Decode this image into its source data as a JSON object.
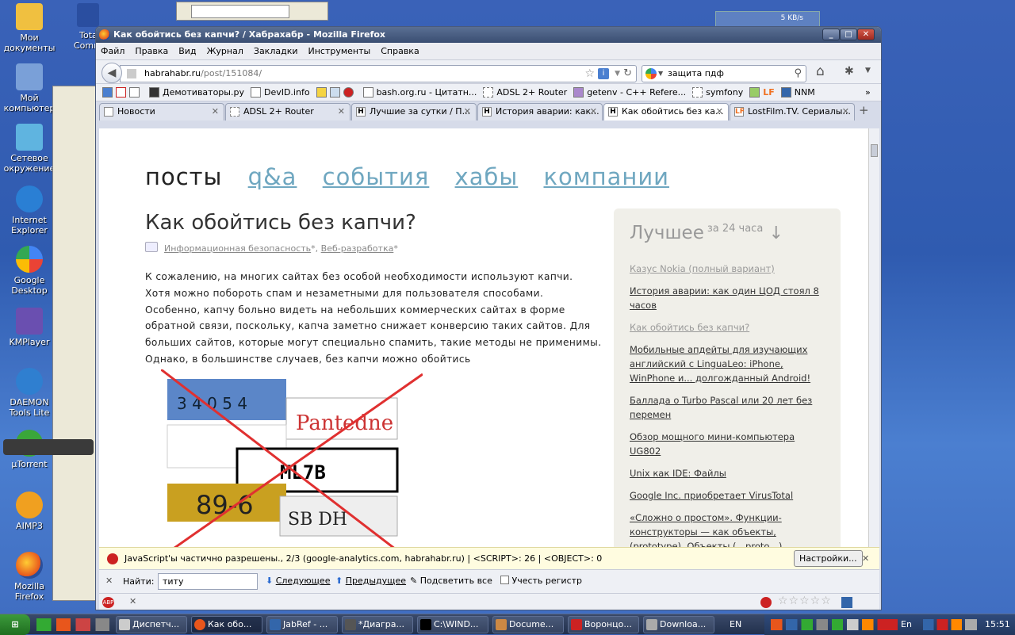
{
  "desktop": {
    "icons": [
      {
        "label": "Мои документы"
      },
      {
        "label": "Мой компьютер"
      },
      {
        "label": "Сетевое окружение"
      },
      {
        "label": "Internet Explorer"
      },
      {
        "label": "Google Desktop"
      },
      {
        "label": "KMPlayer"
      },
      {
        "label": "DAEMON Tools Lite"
      },
      {
        "label": "µTorrent"
      },
      {
        "label": "AIMP3"
      },
      {
        "label": "Mozilla Firefox"
      }
    ],
    "bg_window_label": "Total Comma",
    "netmeter": "5 KB/s"
  },
  "window": {
    "title": "Как обойтись без капчи? / Хабрахабр - Mozilla Firefox",
    "minimize": "_",
    "maximize": "□",
    "close": "✕"
  },
  "menu": [
    "Файл",
    "Правка",
    "Вид",
    "Журнал",
    "Закладки",
    "Инструменты",
    "Справка"
  ],
  "navbar": {
    "url_host": "habrahabr.ru",
    "url_path": "/post/151084/",
    "search_value": "защита пдф"
  },
  "bookmarks": [
    "Демотиваторы.ру",
    "DevID.info",
    "bash.org.ru - Цитатн...",
    "ADSL 2+ Router",
    "getenv - C++ Refere...",
    "symfony",
    "LF",
    "NNM"
  ],
  "tabs": [
    {
      "label": "Новости"
    },
    {
      "label": "ADSL 2+ Router"
    },
    {
      "label": "Лучшие за сутки / П..."
    },
    {
      "label": "История аварии: как..."
    },
    {
      "label": "Как обойтись без ка..."
    },
    {
      "label": "LostFilm.TV. Сериалы..."
    }
  ],
  "page": {
    "nav": {
      "current": "посты",
      "links": [
        "q&a",
        "события",
        "хабы",
        "компании"
      ]
    },
    "title": "Как обойтись без капчи?",
    "tags": [
      "Информационная безопасность",
      "Веб-разработка"
    ],
    "tag_mark": "*",
    "tag_sep": ", ",
    "body_lines": [
      "К сожалению, на многих сайтах без особой необходимости используют капчи.",
      "Хотя можно побороть спам и незаметными для пользователя способами.",
      "Особенно, капчу больно видеть на небольших коммерческих сайтах в форме",
      "обратной связи, поскольку, капча заметно снижает конверсию таких сайтов. Для",
      "больших сайтов, которые могут специально спамить, такие методы не применимы.",
      "Однако, в большинстве случаев, без капчи можно обойтись"
    ],
    "captcha_texts": [
      "3 4 0 5 4",
      "Pantedne",
      "ML7B",
      "89-6",
      "SB DH"
    ],
    "sidebar": {
      "heading": "Лучшее",
      "sub": "за 24 часа",
      "arrow": "↓",
      "items": [
        {
          "text": "Казус Nokia (полный вариант)",
          "visited": true
        },
        {
          "text": "История аварии: как один ЦОД стоял 8 часов",
          "visited": false
        },
        {
          "text": "Как обойтись без капчи?",
          "visited": true
        },
        {
          "text": "Мобильные апдейты для изучающих английский с LinguaLeo: iPhone, WinPhone и... долгожданный Android!",
          "visited": false
        },
        {
          "text": "Баллада о Turbo Pascal или 20 лет без перемен",
          "visited": false
        },
        {
          "text": "Обзор мощного мини-компьютера UG802",
          "visited": false
        },
        {
          "text": "Unix как IDE: Файлы",
          "visited": false
        },
        {
          "text": "Google Inc. приобретает VirusTotal",
          "visited": false
        },
        {
          "text": "«Сложно о простом». Функции-конструкторы — как объекты,(prototype). Объекты,(__proto__). constructor, ={}, как функция-конструктор new Object().",
          "visited": false
        }
      ]
    }
  },
  "jsbar": {
    "text": "JavaScript'ы частично разрешены., 2/3 (google-analytics.com, habrahabr.ru) | <SCRIPT>: 26 | <OBJECT>: 0",
    "settings": "Настройки..."
  },
  "findbar": {
    "label": "Найти:",
    "value": "титу",
    "next": "Следующее",
    "prev": "Предыдущее",
    "highlight": "Подсветить все",
    "matchcase": "Учесть регистр"
  },
  "taskbar": {
    "items": [
      "Диспетч...",
      "Как обо...",
      "JabRef - ...",
      "*Диагра...",
      "C:\\WIND...",
      "Docume...",
      "Воронцо...",
      "Downloa..."
    ],
    "lang": "EN",
    "tray_lang": "En",
    "clock": "15:51"
  }
}
